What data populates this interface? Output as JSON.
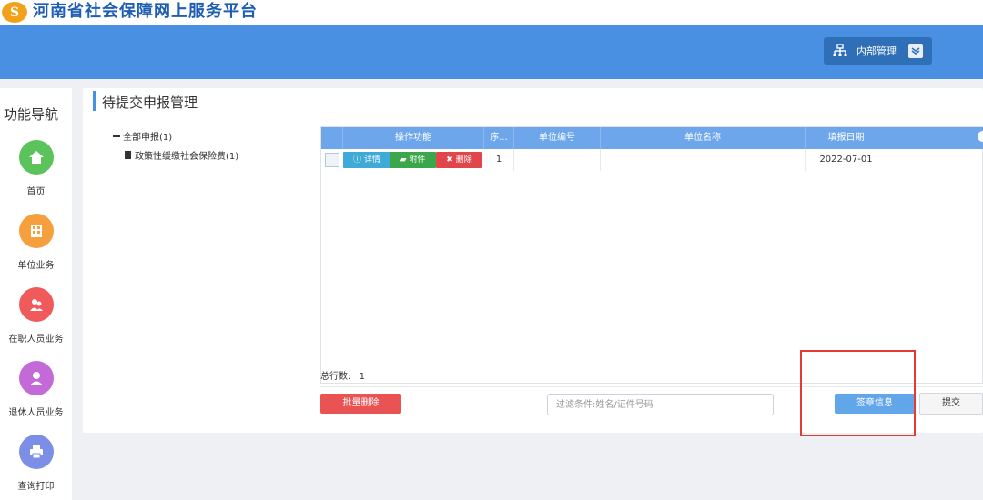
{
  "site": {
    "logo_text": "S",
    "title": "河南省社会保障网上服务平台"
  },
  "header": {
    "menu_label": "内部管理",
    "menu_icon": "org-chart-icon",
    "chevron_icon": "chevron-down-icon"
  },
  "sidenav": {
    "title": "功能导航",
    "items": [
      {
        "label": "首页",
        "icon": "home-icon",
        "color": "#5cc25c"
      },
      {
        "label": "单位业务",
        "icon": "building-icon",
        "color": "#f5a03c"
      },
      {
        "label": "在职人员业务",
        "icon": "people-icon",
        "color": "#f05a5a"
      },
      {
        "label": "退休人员业务",
        "icon": "person-icon",
        "color": "#c46ad8"
      },
      {
        "label": "查询打印",
        "icon": "printer-icon",
        "color": "#7b8fe6"
      }
    ]
  },
  "main": {
    "title": "待提交申报管理",
    "tree": {
      "root": "全部申报(1)",
      "child": "政策性缓缴社会保险费(1)"
    },
    "table": {
      "columns": [
        "操作功能",
        "序...",
        "单位编号",
        "单位名称",
        "填报日期"
      ],
      "rows": [
        {
          "seq": "1",
          "unit_no": "",
          "unit_name": "",
          "date": "2022-07-01"
        }
      ],
      "row_buttons": {
        "detail": "详情",
        "attach": "附件",
        "delete": "删除"
      }
    },
    "total_label": "总行数:",
    "total_value": "1",
    "batch_delete": "批量删除",
    "filter_placeholder": "过滤条件:姓名/证件号码",
    "sign_button": "签章信息",
    "submit_button": "提交"
  },
  "colors": {
    "header_blue": "#4a90e2",
    "highlight": "#e53935"
  }
}
